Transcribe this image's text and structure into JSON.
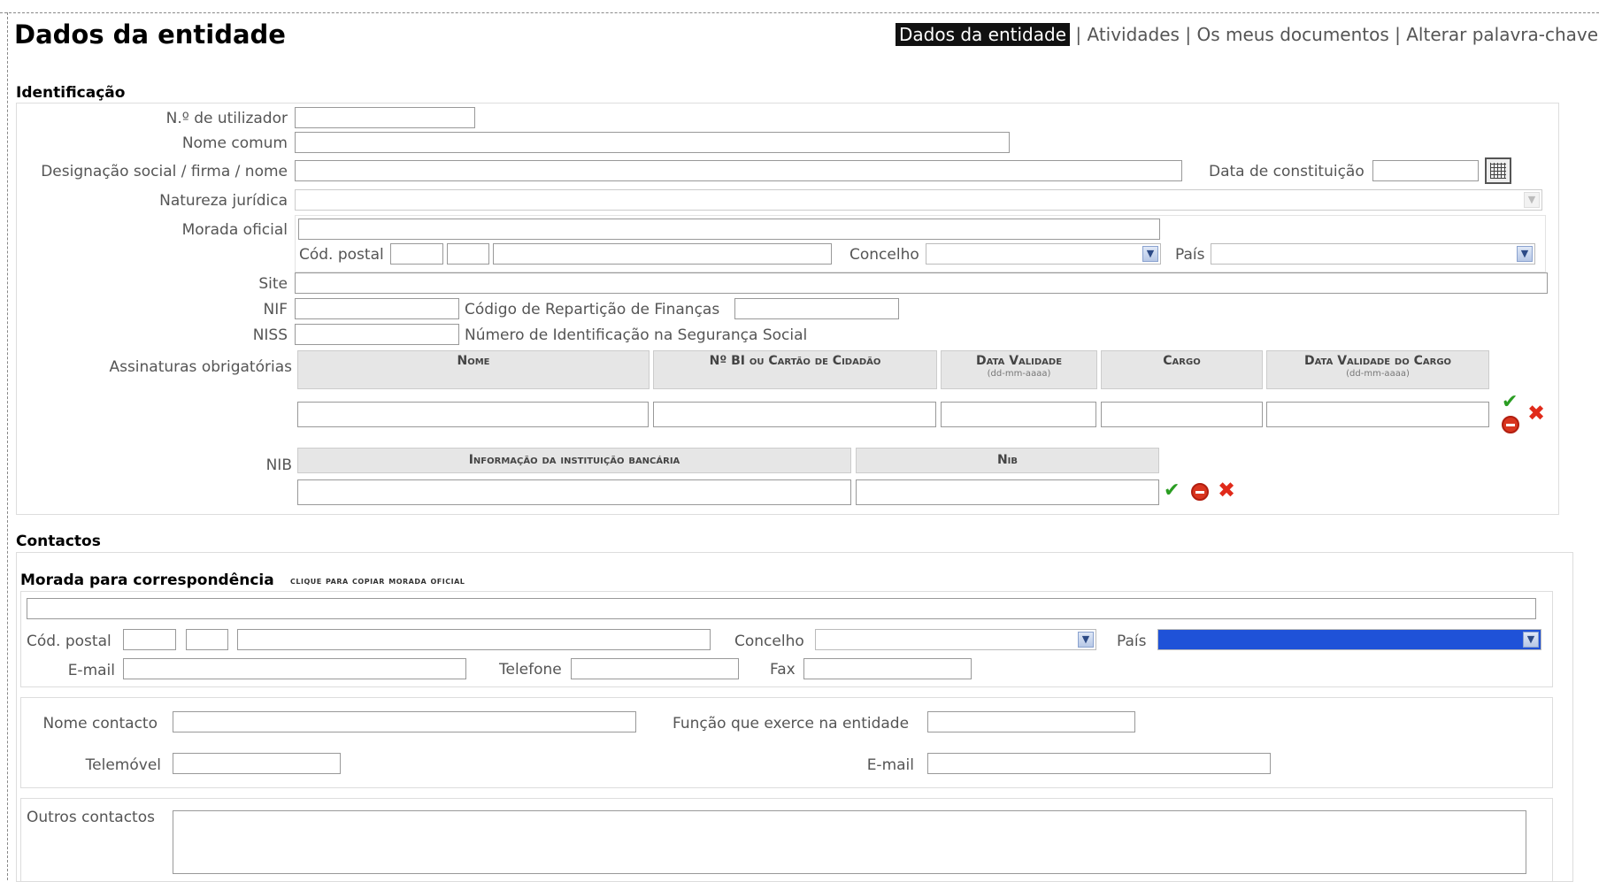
{
  "header": {
    "title": "Dados da entidade",
    "nav": [
      "Dados da entidade",
      "Atividades",
      "Os meus documentos",
      "Alterar palavra-chave"
    ],
    "separator": "|"
  },
  "identificacao": {
    "title": "Identificação",
    "n_utilizador": "N.º de utilizador",
    "nome_comum": "Nome comum",
    "designacao": "Designação social / firma / nome",
    "data_constituicao": "Data de constituição",
    "natureza": "Natureza jurídica",
    "morada": "Morada oficial",
    "cod_postal": "Cód. postal",
    "concelho": "Concelho",
    "pais": "País",
    "site": "Site",
    "nif": "NIF",
    "codigo_reparticao": "Código de Repartição de Finanças",
    "niss": "NISS",
    "niss_desc": "Número de Identificação na Segurança Social",
    "assinaturas": "Assinaturas obrigatórias",
    "assinaturas_cols": [
      {
        "label": "Nome",
        "sub": ""
      },
      {
        "label": "Nº BI ou Cartão de Cidadão",
        "sub": ""
      },
      {
        "label": "Data Validade",
        "sub": "(dd-mm-aaaa)"
      },
      {
        "label": "Cargo",
        "sub": ""
      },
      {
        "label": "Data Validade do Cargo",
        "sub": "(dd-mm-aaaa)"
      }
    ],
    "nib": "NIB",
    "nib_cols": [
      "Informação da instituição bancária",
      "Nib"
    ]
  },
  "contactos": {
    "title": "Contactos",
    "morada_title": "Morada para correspondência",
    "copy_link": "clique para copiar morada oficial",
    "cod_postal": "Cód. postal",
    "concelho": "Concelho",
    "pais": "País",
    "email": "E-mail",
    "telefone": "Telefone",
    "fax": "Fax",
    "nome_contacto": "Nome contacto",
    "funcao": "Função que exerce na entidade",
    "telemovel": "Telemóvel",
    "email2": "E-mail",
    "outros": "Outros contactos"
  },
  "icons": {
    "confirm": "check-icon",
    "cancel": "stop-icon",
    "delete": "x-icon",
    "calendar": "calendar-icon"
  },
  "colors": {
    "selected_country": "#1f52d8",
    "confirm": "#2a9d22",
    "delete": "#e02a1a"
  }
}
